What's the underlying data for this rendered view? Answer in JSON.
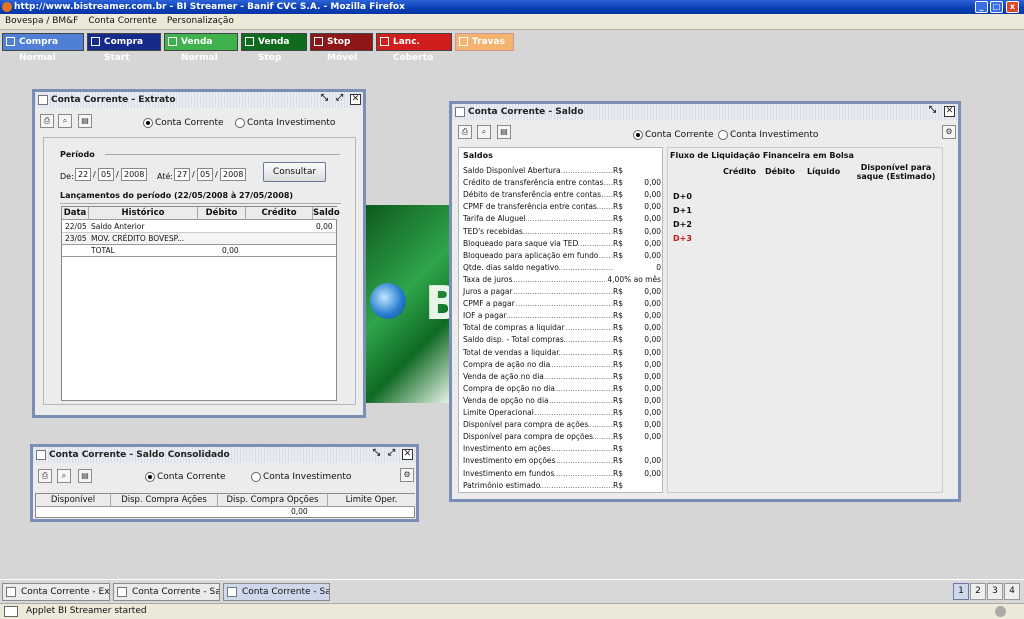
{
  "browser": {
    "title": "http://www.bistreamer.com.br - BI Streamer - Banif CVC S.A. - Mozilla Firefox"
  },
  "menu": [
    "Bovespa / BM&F",
    "Conta Corrente",
    "Personalização"
  ],
  "toolbar": [
    {
      "label": "Compra Normal",
      "color": "#4f7fd6"
    },
    {
      "label": "Compra Start",
      "color": "#152a8a"
    },
    {
      "label": "Venda Normal",
      "color": "#3fb24d"
    },
    {
      "label": "Venda Stop",
      "color": "#0f6b1e"
    },
    {
      "label": "Stop Móvel",
      "color": "#8f1616"
    },
    {
      "label": "Lanc. Coberto",
      "color": "#d21d1d"
    },
    {
      "label": "Travas",
      "color": "#f4b470"
    }
  ],
  "extrato": {
    "title": "Conta Corrente - Extrato",
    "radio_cc": "Conta Corrente",
    "radio_ci": "Conta Investimento",
    "periodo": "Período",
    "de": "De:",
    "ate": "Até:",
    "de_d": "22",
    "de_m": "05",
    "de_y": "2008",
    "ate_d": "27",
    "ate_m": "05",
    "ate_y": "2008",
    "consultar": "Consultar",
    "lanc_title": "Lançamentos do período (22/05/2008 à 27/05/2008)",
    "cols": [
      "Data",
      "Histórico",
      "Débito",
      "Crédito",
      "Saldo"
    ],
    "rows": [
      {
        "data": "22/05",
        "hist": "Saldo Anterior",
        "debito": "",
        "credito": "",
        "saldo": "0,00"
      },
      {
        "data": "23/05",
        "hist": "MOV. CRÉDITO BOVESP...",
        "debito": "",
        "credito": "",
        "saldo": ""
      },
      {
        "data": "",
        "hist": "TOTAL",
        "debito": "0,00",
        "credito": "",
        "saldo": ""
      }
    ]
  },
  "consolidado": {
    "title": "Conta Corrente - Saldo Consolidado",
    "radio_cc": "Conta Corrente",
    "radio_ci": "Conta Investimento",
    "cols": [
      "Disponível",
      "Disp. Compra Ações",
      "Disp. Compra Opções",
      "Limite Oper."
    ],
    "vals": [
      "",
      "",
      "0,00",
      ""
    ]
  },
  "saldo": {
    "title": "Conta Corrente - Saldo",
    "radio_cc": "Conta Corrente",
    "radio_ci": "Conta Investimento",
    "saldos_title": "Saldos",
    "items": [
      {
        "label": "Saldo Disponível Abertura",
        "cur": "R$",
        "val": ""
      },
      {
        "label": "Crédito de transferência entre contas",
        "cur": "R$",
        "val": "0,00"
      },
      {
        "label": "Débito de transferência entre contas",
        "cur": "R$",
        "val": "0,00"
      },
      {
        "label": "CPMF de transferência entre contas",
        "cur": "R$",
        "val": "0,00"
      },
      {
        "label": "Tarifa de Aluguel",
        "cur": "R$",
        "val": "0,00"
      },
      {
        "label": "TED's recebidas",
        "cur": "R$",
        "val": "0,00"
      },
      {
        "label": "Bloqueado para saque via TED",
        "cur": "R$",
        "val": "0,00"
      },
      {
        "label": "Bloqueado para aplicação em fundo",
        "cur": "R$",
        "val": "0,00"
      },
      {
        "label": "Qtde. dias saldo negativo",
        "cur": "",
        "val": "0"
      },
      {
        "label": "Taxa de juros",
        "cur": "",
        "val": "4,00% ao mês"
      },
      {
        "label": "Juros a pagar",
        "cur": "R$",
        "val": "0,00"
      },
      {
        "label": "CPMF a pagar",
        "cur": "R$",
        "val": "0,00"
      },
      {
        "label": "IOF a pagar",
        "cur": "R$",
        "val": "0,00"
      },
      {
        "label": "Total de compras a liquidar",
        "cur": "R$",
        "val": "0,00"
      },
      {
        "label": "Saldo disp. - Total compras",
        "cur": "R$",
        "val": "0,00"
      },
      {
        "label": "Total de vendas a liquidar",
        "cur": "R$",
        "val": "0,00"
      },
      {
        "label": "Compra de ação no dia",
        "cur": "R$",
        "val": "0,00"
      },
      {
        "label": "Venda de ação no dia",
        "cur": "R$",
        "val": "0,00"
      },
      {
        "label": "Compra de opção no dia",
        "cur": "R$",
        "val": "0,00"
      },
      {
        "label": "Venda de opção no dia",
        "cur": "R$",
        "val": "0,00"
      },
      {
        "label": "Limite Operacional",
        "cur": "R$",
        "val": "0,00"
      },
      {
        "label": "Disponível para compra de ações",
        "cur": "R$",
        "val": "0,00"
      },
      {
        "label": "Disponível para compra de opções",
        "cur": "R$",
        "val": "0,00"
      },
      {
        "label": "Investimento em ações",
        "cur": "R$",
        "val": ""
      },
      {
        "label": "Investimento em opções",
        "cur": "R$",
        "val": "0,00"
      },
      {
        "label": "Investimento em fundos",
        "cur": "R$",
        "val": "0,00"
      },
      {
        "label": "Patrimônio estimado",
        "cur": "R$",
        "val": ""
      }
    ],
    "fluxo_title": "Fluxo de Liquidação Financeira em Bolsa",
    "fluxo_cols": [
      "Crédito",
      "Débito",
      "Líquido",
      "Disponível para saque (Estimado)"
    ],
    "fluxo_rows": [
      "D+0",
      "D+1",
      "D+2",
      "D+3"
    ]
  },
  "taskbar": [
    "Conta Corrente - Extr...",
    "Conta Corrente - Sal...",
    "Conta Corrente - Sal..."
  ],
  "pages": [
    "1",
    "2",
    "3",
    "4"
  ],
  "status": "Applet BI Streamer started"
}
